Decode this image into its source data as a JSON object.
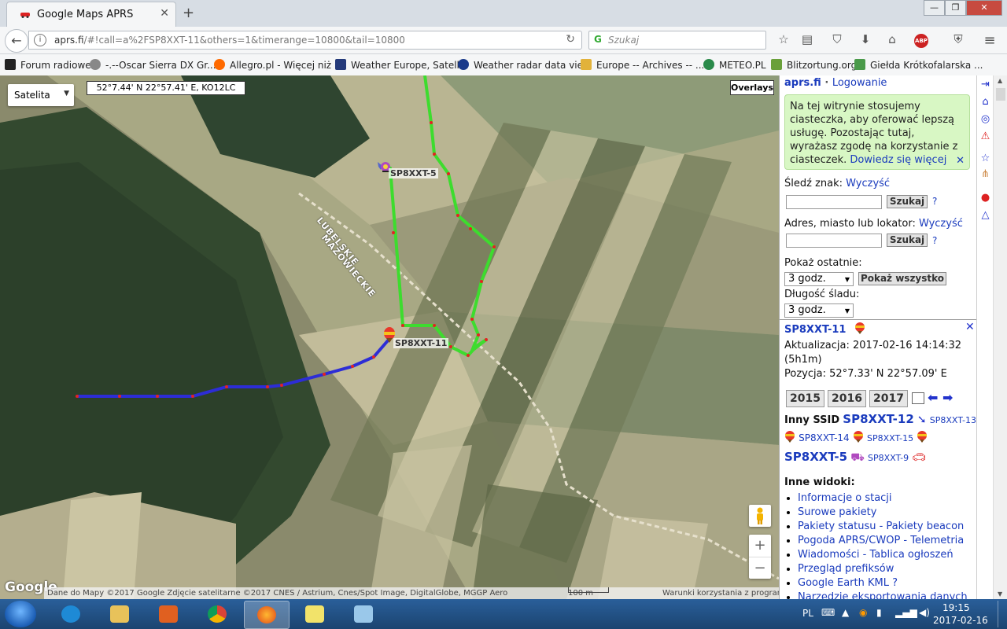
{
  "browser": {
    "tab_title": "Google Maps APRS",
    "url_host": "aprs.fi",
    "url_rest": "/#!call=a%2FSP8XXT-11&others=1&timerange=10800&tail=10800",
    "search_placeholder": "Szukaj"
  },
  "bookmarks": [
    {
      "label": "Forum radiowe",
      "color": "#222222"
    },
    {
      "label": "-.--Oscar Sierra DX Gr...",
      "color": "#888888"
    },
    {
      "label": "Allegro.pl - Więcej niż ...",
      "color": "#ff6a00"
    },
    {
      "label": "Weather Europe, Satell...",
      "color": "#243a7a"
    },
    {
      "label": "Weather radar data vie...",
      "color": "#1a3a8a"
    },
    {
      "label": "Europe -- Archives -- ...",
      "color": "#e2b23a"
    },
    {
      "label": "METEO.PL",
      "color": "#2a8a4a"
    },
    {
      "label": "Blitzortung.org",
      "color": "#6aa03a"
    },
    {
      "label": "Giełda Krótkofalarska ...",
      "color": "#4a9a4a"
    }
  ],
  "map": {
    "type_selector": "Satelita",
    "coords": "52°7.44' N 22°57.41' E, KO12LC",
    "overlays_label": "Overlays",
    "region_label_1": "LUBELSKIE",
    "region_label_2": "MAZOWIECKIE",
    "station_5_label": "SP8XXT-5",
    "station_11_label": "SP8XXT-11",
    "google_logo": "Google",
    "attribution": "Dane do Mapy ©2017 Google Zdjęcie satelitarne ©2017 CNES / Astrium, Cnes/Spot Image, DigitalGlobe, MGGP Aero",
    "scale_label": "100 m",
    "terms_label": "Warunki korzystania z programu",
    "track_green_color": "#3ddc2e",
    "track_blue_color": "#2d2dd6"
  },
  "panel": {
    "site": "aprs.fi",
    "login": "Logowanie",
    "cookie_text": "Na tej witrynie stosujemy ciasteczka, aby oferować lepszą usługę. Pozostając tutaj, wyrażasz zgodę na korzystanie z ciasteczek.",
    "cookie_link": "Dowiedz się więcej",
    "track_label": "Śledź znak:",
    "clear_1": "Wyczyść",
    "search_btn": "Szukaj",
    "address_label": "Adres, miasto lub lokator:",
    "clear_2": "Wyczyść",
    "show_last_label": "Pokaż ostatnie:",
    "show_last_value": "3 godz.",
    "show_all_btn": "Pokaż wszystko",
    "tail_label": "Długość śladu:",
    "tail_value": "3 godz.",
    "station": "SP8XXT-11",
    "updated": "Aktualizacja: 2017-02-16 14:14:32",
    "updated_ago": "(5h1m)",
    "position": "Pozycja: 52°7.33' N 22°57.09' E",
    "years": [
      "2015",
      "2016",
      "2017"
    ],
    "other_ssid_label": "Inny SSID",
    "ssid_12": "SP8XXT-12",
    "ssid_13": "SP8XXT-13",
    "ssid_14": "SP8XXT-14",
    "ssid_15": "SP8XXT-15",
    "ssid_5": "SP8XXT-5",
    "ssid_9": "SP8XXT-9",
    "other_views_label": "Inne widoki:",
    "views": [
      "Informacje o stacji",
      "Surowe pakiety",
      "Pakiety statusu - Pakiety beacon",
      "Pogoda APRS/CWOP - Telemetria",
      "Wiadomości - Tablica ogłoszeń",
      "Przegląd prefiksów",
      "Google Earth KML ?",
      "Narzędzie eksportowania danych"
    ]
  },
  "taskbar": {
    "lang": "PL",
    "time": "19:15",
    "date": "2017-02-16"
  }
}
